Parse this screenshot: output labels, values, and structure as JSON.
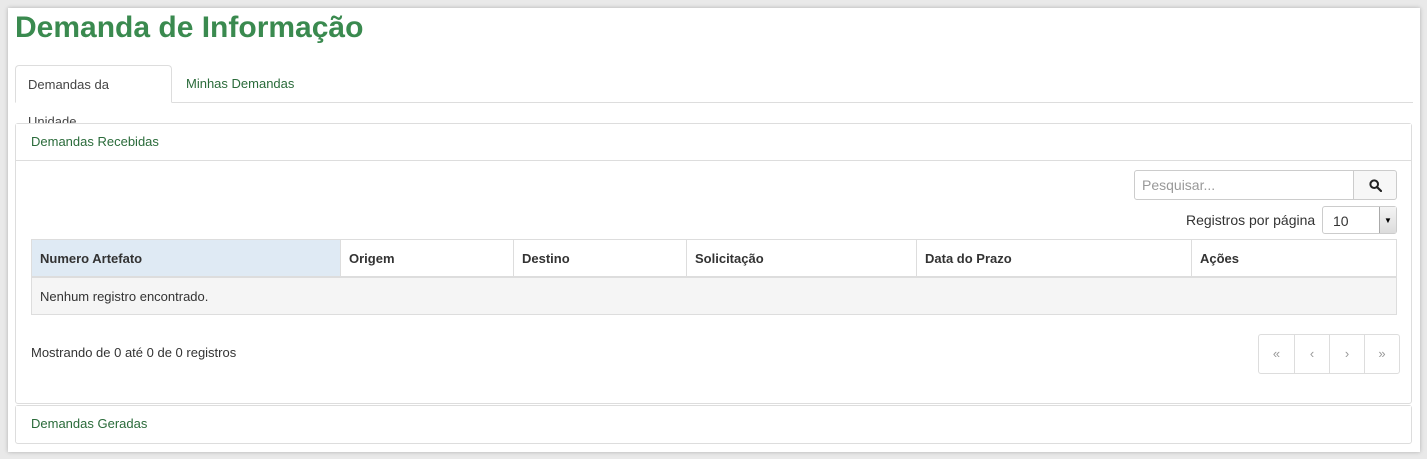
{
  "page": {
    "title": "Demanda de Informação"
  },
  "tabs": [
    {
      "label": "Demandas da Unidade",
      "active": true
    },
    {
      "label": "Minhas Demandas",
      "active": false
    }
  ],
  "received": {
    "heading": "Demandas Recebidas",
    "search": {
      "placeholder": "Pesquisar...",
      "value": ""
    },
    "per_page": {
      "label": "Registros por página",
      "value": "10"
    },
    "columns": [
      "Numero Artefato",
      "Origem",
      "Destino",
      "Solicitação",
      "Data do Prazo",
      "Ações"
    ],
    "empty_message": "Nenhum registro encontrado.",
    "info": "Mostrando de 0 até 0 de 0 registros",
    "pager": {
      "first": "«",
      "prev": "‹",
      "next": "›",
      "last": "»"
    }
  },
  "generated": {
    "heading": "Demandas Geradas"
  },
  "colors": {
    "title": "#3a8a4f",
    "link": "#2a6b3a",
    "sorted_header": "#dfeaf4"
  },
  "icons": {
    "search": "search-icon",
    "dropdown": "caret-down-icon"
  }
}
